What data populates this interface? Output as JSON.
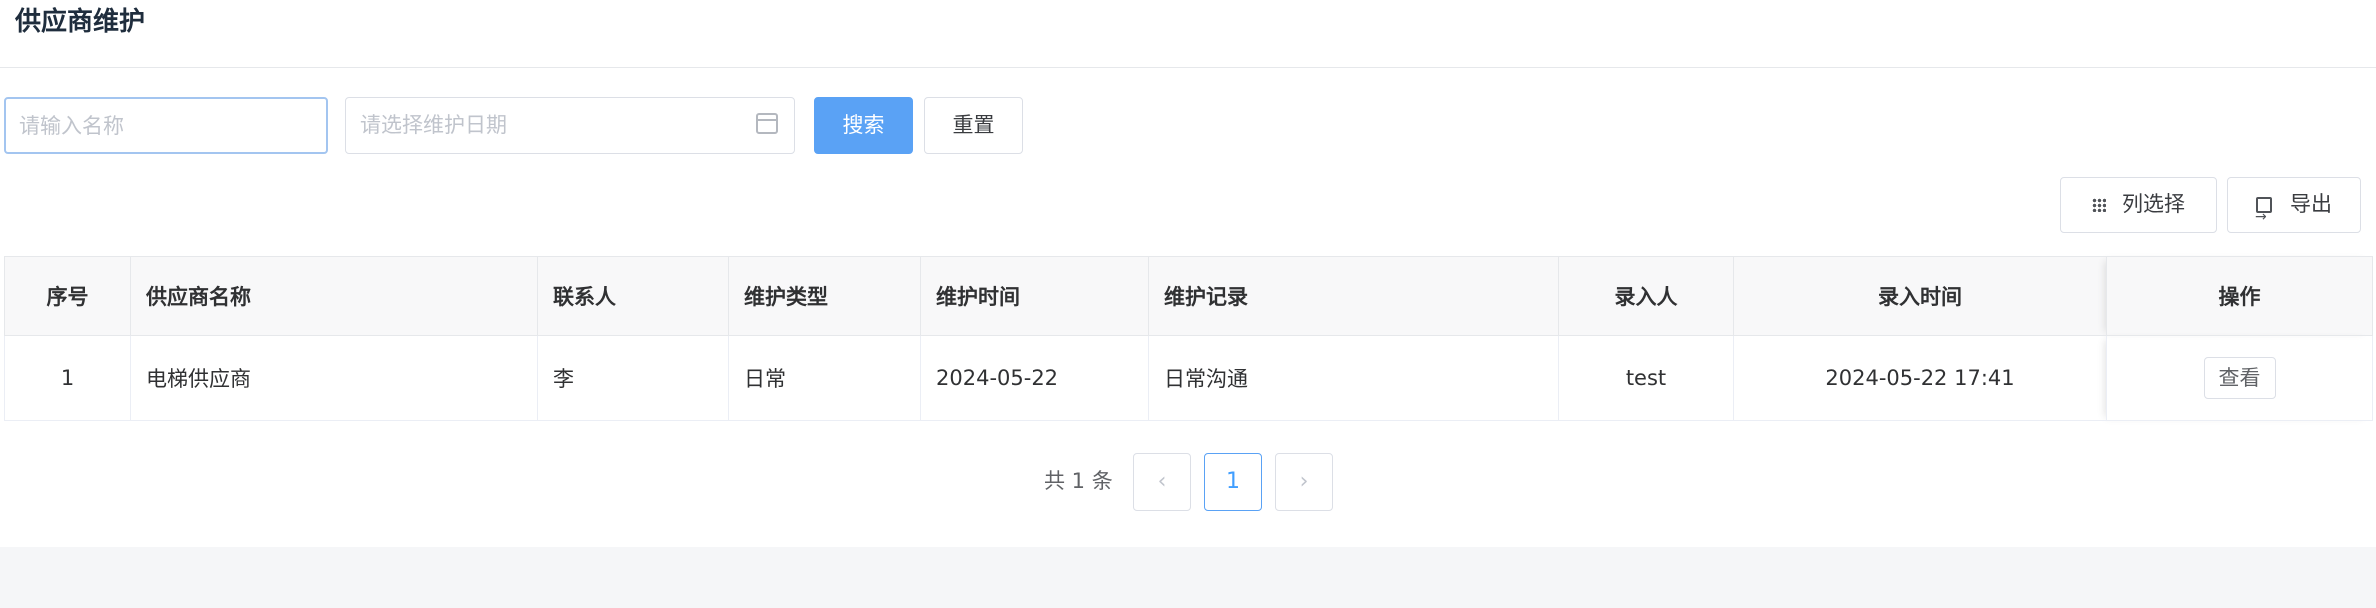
{
  "page": {
    "title": "供应商维护"
  },
  "search": {
    "name_placeholder": "请输入名称",
    "date_placeholder": "请选择维护日期",
    "search_label": "搜索",
    "reset_label": "重置"
  },
  "toolbar": {
    "columns_label": "列选择",
    "export_label": "导出"
  },
  "table": {
    "headers": [
      "序号",
      "供应商名称",
      "联系人",
      "维护类型",
      "维护时间",
      "维护记录",
      "录入人",
      "录入时间",
      "操作"
    ],
    "rows": [
      {
        "index": "1",
        "supplier": "电梯供应商",
        "contact": "李",
        "type": "日常",
        "time": "2024-05-22",
        "record": "日常沟通",
        "entered_by": "test",
        "entered_at": "2024-05-22 17:41",
        "action": "查看"
      }
    ]
  },
  "pagination": {
    "total_text": "共 1 条",
    "prev": "‹",
    "current": "1",
    "next": "›"
  }
}
